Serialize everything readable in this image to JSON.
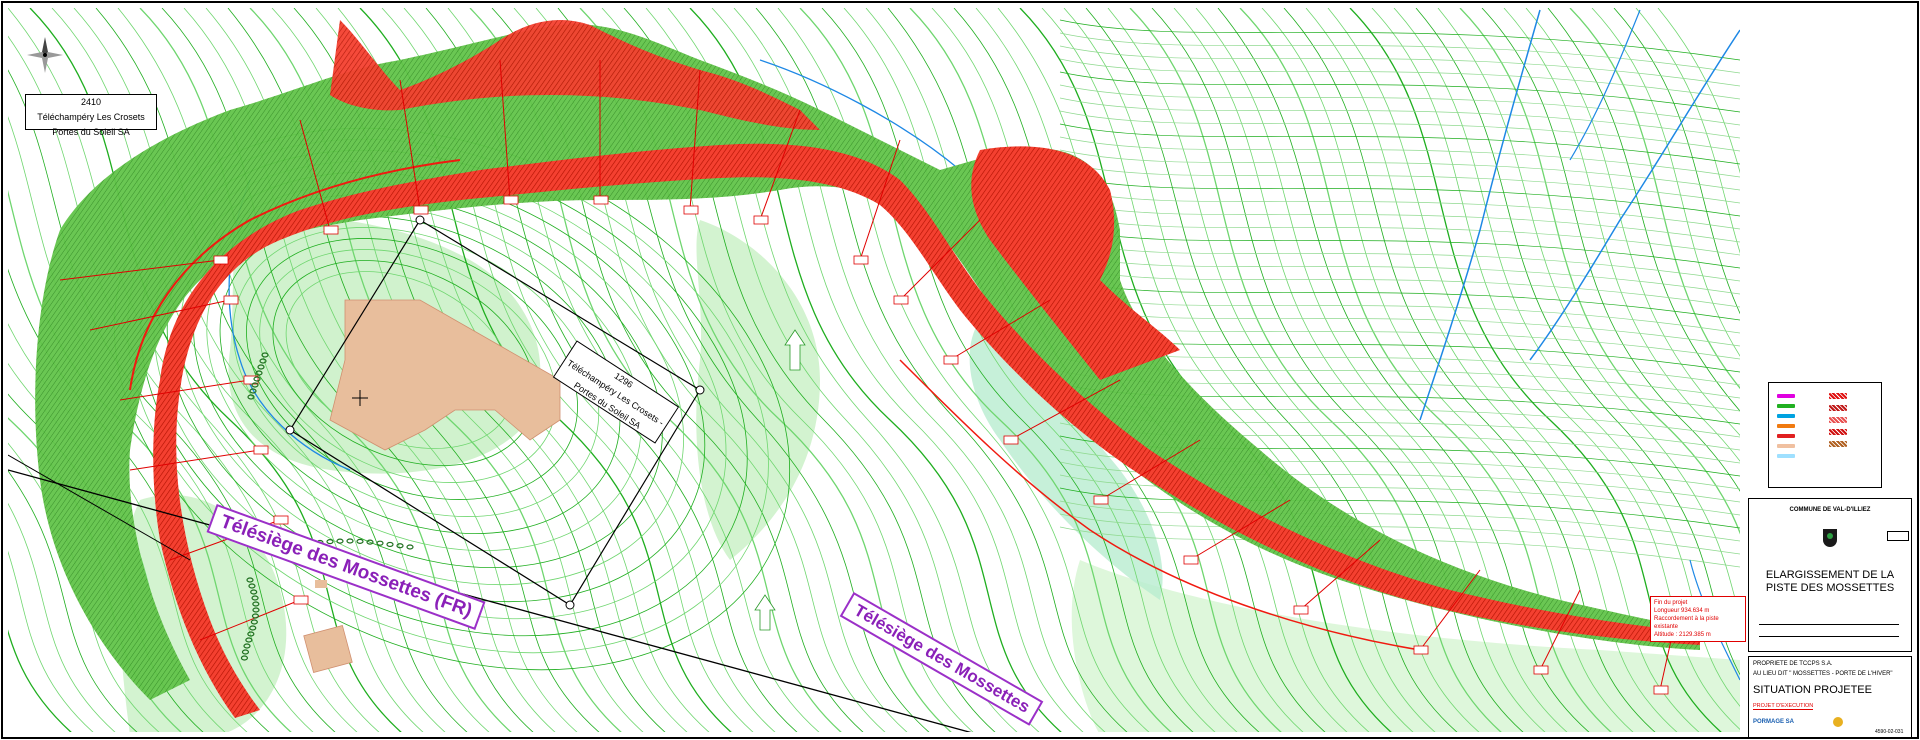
{
  "labels": {
    "parcel_top_left": {
      "number": "2410",
      "line1": "Téléchampéry Les Crosets",
      "line2": "Portes du Soleil SA"
    },
    "parcel_center": {
      "number": "1296",
      "line1": "Téléchampéry Les Crosets -",
      "line2": "Portes du Soleil SA"
    },
    "lift_fr": "Télésiège des Mossettes (FR)",
    "lift_ch": "Télésiège des Mossettes"
  },
  "end_note": {
    "line1": "Fin du projet",
    "line2": "Longueur 934.634 m",
    "line3": "Raccordement à la piste existante",
    "line4": "Altitude : 2129.385 m"
  },
  "title_block": {
    "commune": "COMMUNE DE VAL-D'ILLIEZ",
    "title": "ELARGISSEMENT DE LA PISTE DES MOSSETTES",
    "owner": "PROPRIETE DE TCCPS S.A.",
    "lieu": "AU LIEU DIT \" MOSSETTES - PORTE DE L'HIVER\"",
    "subtitle": "SITUATION PROJETEE",
    "phase": "PROJET D'EXECUTION",
    "company": "PORMAGE SA",
    "drawing_no": "4590-02-031"
  },
  "colors": {
    "contour": "#1fae1f",
    "contour_light": "#6fd66f",
    "fill_light": "#c8f0c4",
    "piste_red": "#f01a10",
    "piste_green": "#56bb3a",
    "building": "#e8be9c",
    "water": "#1e88e5",
    "lift_purple": "#9b30c8"
  },
  "legend_swatches": [
    {
      "color": "#e000e0"
    },
    {
      "color": "#21b021"
    },
    {
      "color": "#00a2e0"
    },
    {
      "color": "#f07a10"
    },
    {
      "color": "#e02020"
    },
    {
      "color": "#f0c0a0"
    },
    {
      "color": "#9fe0ff"
    }
  ],
  "legend_swatches_right": [
    {
      "color": "#e01010"
    },
    {
      "color": "#c01818"
    },
    {
      "color": "#e85050"
    },
    {
      "color": "#d01010"
    },
    {
      "color": "#b06020"
    }
  ]
}
